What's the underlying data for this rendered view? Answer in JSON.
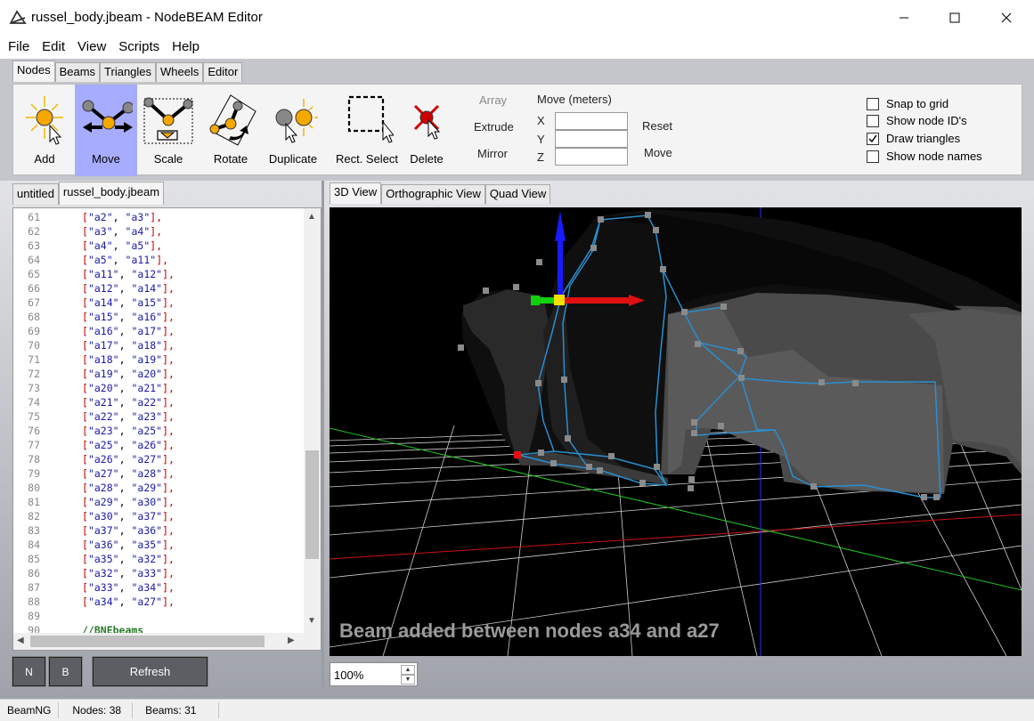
{
  "window": {
    "title": "russel_body.jbeam - NodeBEAM Editor"
  },
  "menu": [
    "File",
    "Edit",
    "View",
    "Scripts",
    "Help"
  ],
  "tool_tabs": [
    "Nodes",
    "Beams",
    "Triangles",
    "Wheels",
    "Editor"
  ],
  "tools": {
    "add": "Add",
    "move": "Move",
    "scale": "Scale",
    "rotate": "Rotate",
    "duplicate": "Duplicate",
    "rect_select": "Rect. Select",
    "delete": "Delete"
  },
  "ops": {
    "array": "Array",
    "extrude": "Extrude",
    "mirror": "Mirror"
  },
  "move_panel": {
    "title": "Move (meters)",
    "x": "X",
    "y": "Y",
    "z": "Z",
    "reset": "Reset",
    "move": "Move"
  },
  "options": [
    {
      "label": "Snap to grid",
      "checked": false
    },
    {
      "label": "Show node ID's",
      "checked": false
    },
    {
      "label": "Draw triangles",
      "checked": true
    },
    {
      "label": "Show node names",
      "checked": false
    }
  ],
  "file_tabs": [
    "untitled",
    "russel_body.jbeam"
  ],
  "code": [
    {
      "n": "61",
      "a": "a2",
      "b": "a3",
      "end": "],"
    },
    {
      "n": "62",
      "a": "a3",
      "b": "a4",
      "end": "],"
    },
    {
      "n": "63",
      "a": "a4",
      "b": "a5",
      "end": "],"
    },
    {
      "n": "64",
      "a": "a5",
      "b": "a11",
      "end": "],"
    },
    {
      "n": "65",
      "a": "a11",
      "b": "a12",
      "end": "],"
    },
    {
      "n": "66",
      "a": "a12",
      "b": "a14",
      "end": "],"
    },
    {
      "n": "67",
      "a": "a14",
      "b": "a15",
      "end": "],"
    },
    {
      "n": "68",
      "a": "a15",
      "b": "a16",
      "end": "],"
    },
    {
      "n": "69",
      "a": "a16",
      "b": "a17",
      "end": "],"
    },
    {
      "n": "70",
      "a": "a17",
      "b": "a18",
      "end": "],"
    },
    {
      "n": "71",
      "a": "a18",
      "b": "a19",
      "end": "],"
    },
    {
      "n": "72",
      "a": "a19",
      "b": "a20",
      "end": "],"
    },
    {
      "n": "73",
      "a": "a20",
      "b": "a21",
      "end": "],"
    },
    {
      "n": "74",
      "a": "a21",
      "b": "a22",
      "end": "],"
    },
    {
      "n": "75",
      "a": "a22",
      "b": "a23",
      "end": "],"
    },
    {
      "n": "76",
      "a": "a23",
      "b": "a25",
      "end": "],"
    },
    {
      "n": "77",
      "a": "a25",
      "b": "a26",
      "end": "],"
    },
    {
      "n": "78",
      "a": "a26",
      "b": "a27",
      "end": "],"
    },
    {
      "n": "79",
      "a": "a27",
      "b": "a28",
      "end": "],"
    },
    {
      "n": "80",
      "a": "a28",
      "b": "a29",
      "end": "],"
    },
    {
      "n": "81",
      "a": "a29",
      "b": "a30",
      "end": "],"
    },
    {
      "n": "82",
      "a": "a30",
      "b": "a37",
      "end": "],"
    },
    {
      "n": "83",
      "a": "a37",
      "b": "a36",
      "end": "],"
    },
    {
      "n": "84",
      "a": "a36",
      "b": "a35",
      "end": "],"
    },
    {
      "n": "85",
      "a": "a35",
      "b": "a32",
      "end": "],"
    },
    {
      "n": "86",
      "a": "a32",
      "b": "a33",
      "end": "],"
    },
    {
      "n": "87",
      "a": "a33",
      "b": "a34",
      "end": "],"
    },
    {
      "n": "88",
      "a": "a34",
      "b": "a27",
      "end": "],"
    }
  ],
  "code_tail": {
    "n89": "89",
    "n90": "90",
    "comment": "//BNEbeams"
  },
  "bottom_buttons": {
    "n": "N",
    "b": "B",
    "refresh": "Refresh"
  },
  "view_tabs": [
    "3D View",
    "Orthographic View",
    "Quad View"
  ],
  "viewport": {
    "message": "Beam added between nodes a34 and a27"
  },
  "zoom": "100%",
  "statusbar": {
    "app": "BeamNG",
    "nodes": "Nodes: 38",
    "beams": "Beams: 31"
  }
}
